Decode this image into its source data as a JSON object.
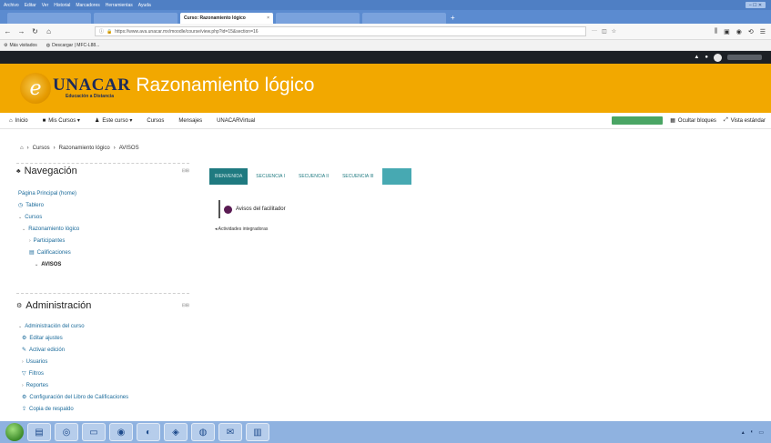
{
  "browser": {
    "menu": [
      "Archivo",
      "Editar",
      "Ver",
      "Historial",
      "Marcadores",
      "Herramientas",
      "Ayuda"
    ],
    "tabs": [
      {
        "label": "",
        "active": false
      },
      {
        "label": "",
        "active": false
      },
      {
        "label": "Curso: Razonamiento lógico",
        "active": true
      },
      {
        "label": "",
        "active": false
      },
      {
        "label": "",
        "active": false
      }
    ],
    "tab_close": "×",
    "new_tab": "+",
    "url": "https://www.ava.unacar.mx/moodle/course/view.php?id=15&section=16",
    "bookmarks": [
      "Más visitados",
      "Descargar | MFC-L88..."
    ]
  },
  "site": {
    "logo_name": "UNACAR",
    "logo_tag": "Educación a Distancia",
    "logo_letter": "e",
    "course_title": "Razonamiento lógico"
  },
  "navbar": {
    "items": [
      "Inicio",
      "Mis Cursos ▾",
      "Este curso ▾",
      "Cursos",
      "Mensajes",
      "UNACARVirtual"
    ],
    "hide_blocks": "Ocultar bloques",
    "standard_view": "Vista estándar"
  },
  "breadcrumb": {
    "home_icon": "⌂",
    "sep": "›",
    "items": [
      "Cursos",
      "Razonamiento lógico",
      "AVISOS"
    ]
  },
  "navigation_block": {
    "title": "Navegación",
    "items": [
      {
        "label": "Página Principal (home)"
      },
      {
        "label": "Tablero"
      },
      {
        "label": "Cursos"
      },
      {
        "label": "Razonamiento lógico"
      },
      {
        "label": "Participantes"
      },
      {
        "label": "Calificaciones"
      },
      {
        "label": "AVISOS"
      }
    ]
  },
  "admin_block": {
    "title": "Administración",
    "items": [
      {
        "label": "Administración del curso"
      },
      {
        "label": "Editar ajustes"
      },
      {
        "label": "Activar edición"
      },
      {
        "label": "Usuarios"
      },
      {
        "label": "Filtros"
      },
      {
        "label": "Reportes"
      },
      {
        "label": "Configuración del Libro de Calificaciones"
      },
      {
        "label": "Copia de respaldo"
      }
    ]
  },
  "section_tabs": [
    "BIENVENIDA",
    "SECUENCIA I",
    "SECUENCIA II",
    "SECUENCIA III",
    ""
  ],
  "section": {
    "forum_label": "Avisos del facilitador",
    "prev_link": "◂ Actividades integradoras"
  },
  "colors": {
    "header": "#f2a800",
    "tab_active": "#1f7a80",
    "edit_button": "#4aa564"
  }
}
